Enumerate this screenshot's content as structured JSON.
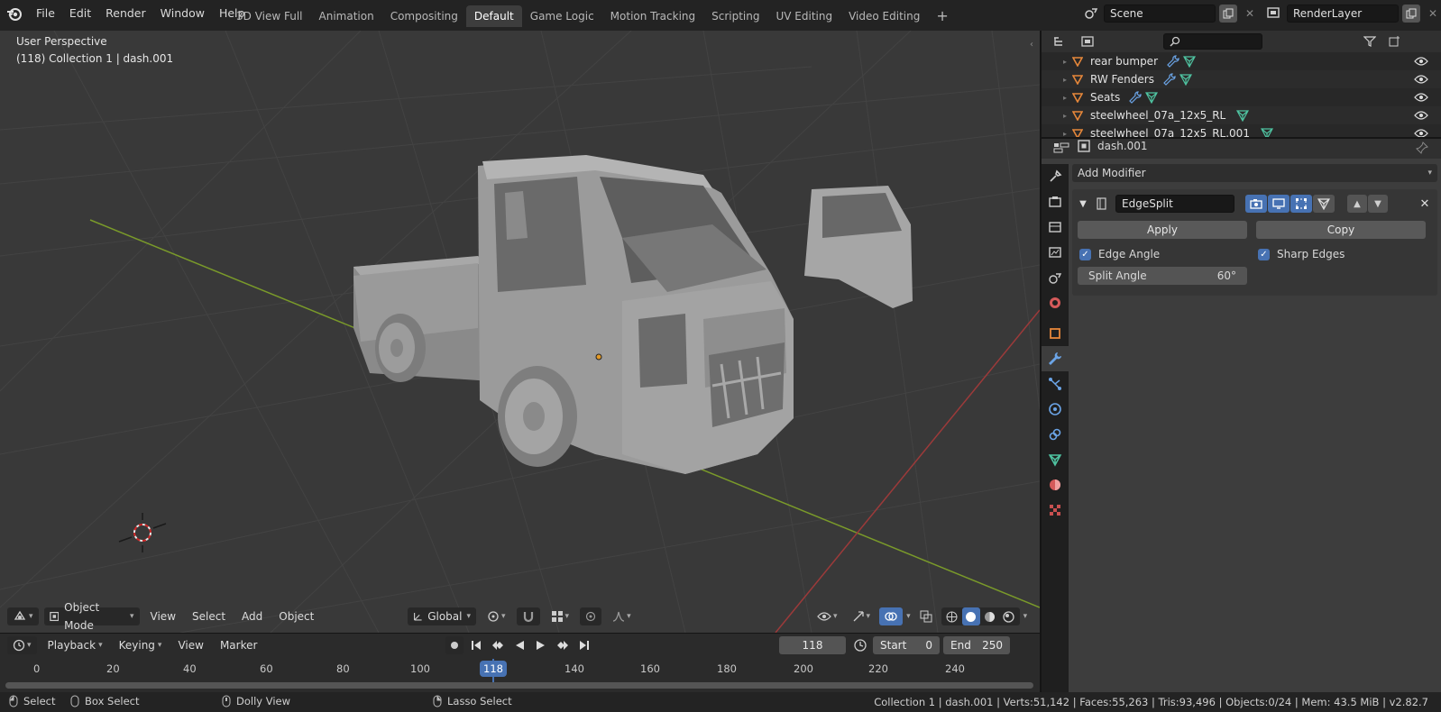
{
  "topbar": {
    "menus": [
      "File",
      "Edit",
      "Render",
      "Window",
      "Help"
    ],
    "workspaces": [
      "3D View Full",
      "Animation",
      "Compositing",
      "Default",
      "Game Logic",
      "Motion Tracking",
      "Scripting",
      "UV Editing",
      "Video Editing"
    ],
    "active_workspace": "Default",
    "add_workspace": "+",
    "scene_name": "Scene",
    "view_layer": "RenderLayer"
  },
  "viewport": {
    "perspective": "User Perspective",
    "info": "(118) Collection 1 | dash.001",
    "mode": "Object Mode",
    "menus": [
      "View",
      "Select",
      "Add",
      "Object"
    ],
    "orientation": "Global"
  },
  "outliner": {
    "search_placeholder": "",
    "items": [
      {
        "name": "rear bumper",
        "icons": [
          "wrench",
          "mesh"
        ]
      },
      {
        "name": "RW Fenders",
        "icons": [
          "wrench",
          "mesh"
        ]
      },
      {
        "name": "Seats",
        "icons": [
          "wrench",
          "mesh"
        ]
      },
      {
        "name": "steelwheel_07a_12x5_RL",
        "icons": [
          "mesh"
        ]
      },
      {
        "name": "steelwheel_07a_12x5_RL.001",
        "icons": [
          "mesh"
        ]
      }
    ]
  },
  "properties": {
    "object_name": "dash.001",
    "add_modifier": "Add Modifier",
    "modifier": {
      "name": "EdgeSplit",
      "apply_label": "Apply",
      "copy_label": "Copy",
      "edge_angle_label": "Edge Angle",
      "edge_angle_checked": true,
      "sharp_edges_label": "Sharp Edges",
      "sharp_edges_checked": true,
      "split_angle_label": "Split Angle",
      "split_angle_value": "60°"
    }
  },
  "timeline": {
    "menus": [
      "Playback",
      "Keying",
      "View",
      "Marker"
    ],
    "current_frame": "118",
    "start_label": "Start",
    "start_value": "0",
    "end_label": "End",
    "end_value": "250",
    "ticks": [
      "0",
      "20",
      "40",
      "60",
      "80",
      "100",
      "140",
      "160",
      "180",
      "200",
      "220",
      "240"
    ],
    "playhead_label": "118"
  },
  "statusbar": {
    "select": "Select",
    "box_select": "Box Select",
    "dolly_view": "Dolly View",
    "lasso_select": "Lasso Select",
    "stats": "Collection 1 | dash.001 | Verts:51,142 | Faces:55,263 | Tris:93,496 | Objects:0/24 | Mem: 43.5 MiB | v2.82.7"
  },
  "colors": {
    "accent": "#4772b3",
    "x_axis": "#9c3a3a",
    "y_axis": "#7a9a2a",
    "mesh_icon": "#4fc3a1",
    "object_icon": "#e6873a"
  }
}
